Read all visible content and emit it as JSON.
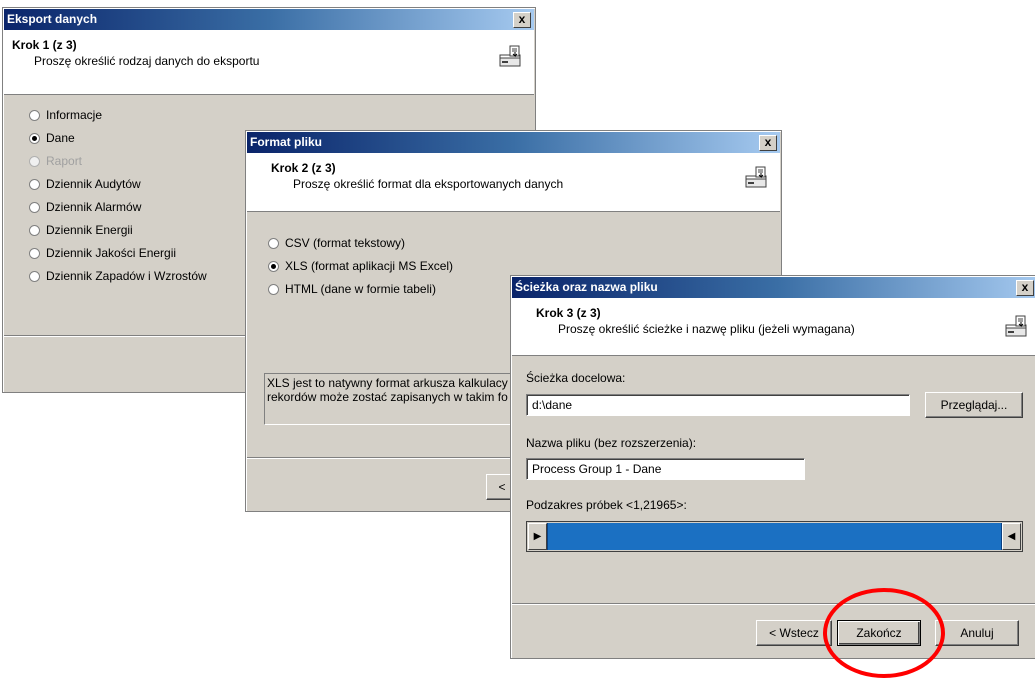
{
  "dialog1": {
    "title": "Eksport danych",
    "step": "Krok 1 (z 3)",
    "subtitle": "Proszę określić rodzaj danych do eksportu",
    "options": [
      {
        "label": "Informacje",
        "checked": false,
        "disabled": false
      },
      {
        "label": "Dane",
        "checked": true,
        "disabled": false
      },
      {
        "label": "Raport",
        "checked": false,
        "disabled": true
      },
      {
        "label": "Dziennik Audytów",
        "checked": false,
        "disabled": false
      },
      {
        "label": "Dziennik Alarmów",
        "checked": false,
        "disabled": false
      },
      {
        "label": "Dziennik Energii",
        "checked": false,
        "disabled": false
      },
      {
        "label": "Dziennik Jakości Energii",
        "checked": false,
        "disabled": false
      },
      {
        "label": "Dziennik Zapadów i Wzrostów",
        "checked": false,
        "disabled": false
      }
    ],
    "close": "x"
  },
  "dialog2": {
    "title": "Format pliku",
    "step": "Krok 2 (z 3)",
    "subtitle": "Proszę określić format dla eksportowanych danych",
    "options": [
      {
        "label": "CSV (format tekstowy)",
        "checked": false
      },
      {
        "label": "XLS (format aplikacji MS Excel)",
        "checked": true
      },
      {
        "label": "HTML (dane w formie tabeli)",
        "checked": false
      }
    ],
    "info_line1": "XLS jest to natywny format arkusza kalkulacy",
    "info_line2": "rekordów może zostać zapisanych w takim fo",
    "back_button_partial": "<",
    "close": "x"
  },
  "dialog3": {
    "title": "Ścieżka oraz nazwa pliku",
    "step": "Krok 3 (z 3)",
    "subtitle": "Proszę określić ścieżke i nazwę pliku (jeżeli wymagana)",
    "dest_label": "Ścieżka docelowa:",
    "dest_value": "d:\\dane",
    "browse_button": "Przeglądaj...",
    "filename_label": "Nazwa pliku (bez rozszerzenia):",
    "filename_value": "Process Group 1 - Dane",
    "range_label": "Podzakres próbek <1,21965>:",
    "range_left_arrow": "▶",
    "range_right_arrow": "◀",
    "back_button": "< Wstecz",
    "finish_button": "Zakończ",
    "cancel_button": "Anuluj",
    "close": "x"
  },
  "colors": {
    "title_start": "#0a246a",
    "title_end": "#a6caf0",
    "dialog_bg": "#d4d0c8",
    "range_bar": "#1b70c2",
    "highlight": "#ff0000"
  }
}
